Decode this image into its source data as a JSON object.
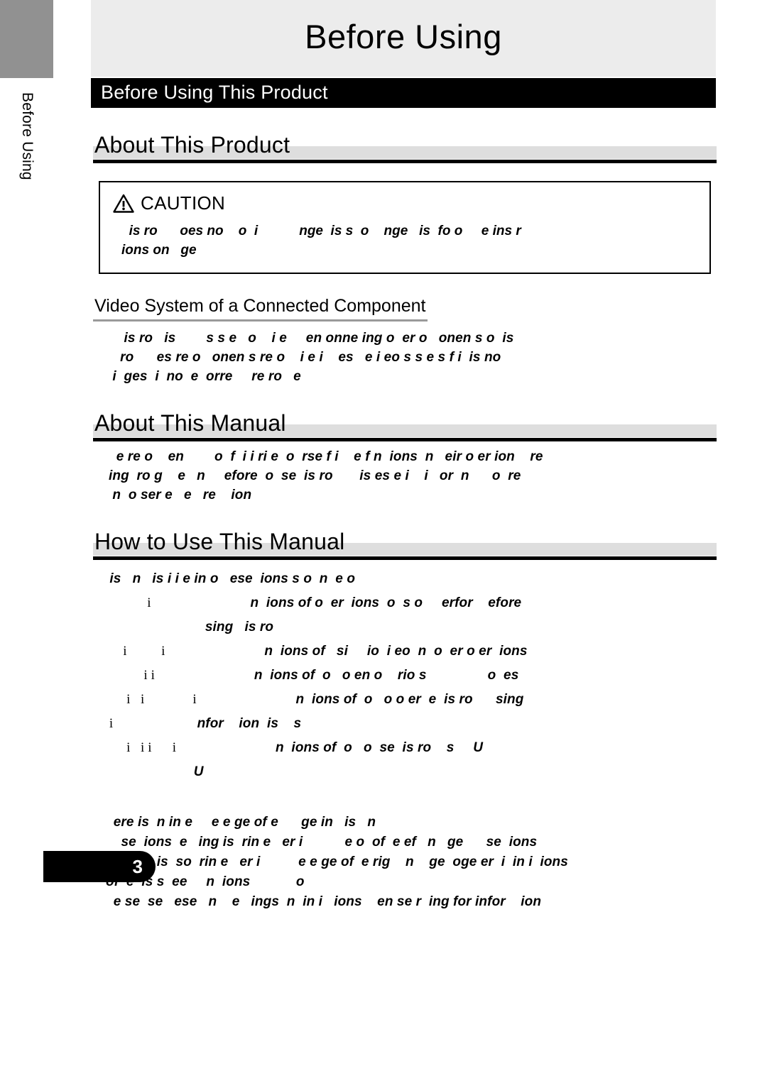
{
  "sidebar": {
    "vertical_label": "Before Using"
  },
  "header": {
    "page_title": "Before Using",
    "section_bar": "Before Using This Product"
  },
  "sections": {
    "about_product": {
      "heading": "About This Product",
      "caution": {
        "icon": "warning-triangle-icon",
        "title": "CAUTION",
        "lines": [
          "  is ro      oes no    o  i           nge  is s  o    nge   is  fo o     e ins r",
          "ions on   ge"
        ]
      },
      "subsection": {
        "heading": "Video System of a Connected Component",
        "lines": [
          "    is ro   is        s s e   o    i e     en onne ing o  er o   onen s o  is",
          "   ro      es re o   onen s re o    i e i    es   e i eo s s e s f i  is no",
          " i  ges  i  no  e  orre     re ro   e"
        ]
      }
    },
    "about_manual": {
      "heading": "About This Manual",
      "lines": [
        "  e re o    en        o  f  i i ri e  o  rse f i    e f n  ions  n   eir o er ion    re",
        "ing  ro g    e   n     efore  o  se  is ro       is es e i    i   or  n      o  re",
        " n  o ser e   e   re    ion"
      ]
    },
    "how_to_use": {
      "heading": "How to Use This Manual",
      "intro": " is   n   is i i e in o   ese  ions s o  n  e o",
      "rows": [
        {
          "marker": "            i",
          "text": "                          n  ions of o  er  ions  o  s o     erfor    efore"
        },
        {
          "marker": "",
          "text": "                          sing   is ro"
        },
        {
          "marker": "     i          i",
          "text": "                          n  ions of   si     io  i eo  n  o  er o er  ions"
        },
        {
          "marker": "           i i",
          "text": "                          n  ions of  o   o en o    rio s                o  es"
        },
        {
          "marker": "      i   i              i",
          "text": "                          n  ions of  o   o o er  e  is ro      sing"
        },
        {
          "marker": " i",
          "text": "                      nfor    ion  is    s"
        },
        {
          "marker": "      i   i i      i",
          "text": "                          n  ions of  o   o  se  is ro    s     U"
        },
        {
          "marker": "",
          "text": "                       U"
        }
      ],
      "closing_lines": [
        "  ere is  n in e     e e ge of e      ge in   is   n",
        "    se  ions  e   ing is  rin e   er i           e o  of  e ef   n   ge      se  ions",
        "  e   ing is  so  rin e   er i          e e ge of  e rig    n    ge  oge er  i  in i  ions",
        "of  e  is s  ee     n  ions            o",
        "  e se  se   ese   n    e   ings  n  in i   ions    en se r  ing for infor    ion"
      ]
    }
  },
  "footer": {
    "page_number": "3"
  }
}
